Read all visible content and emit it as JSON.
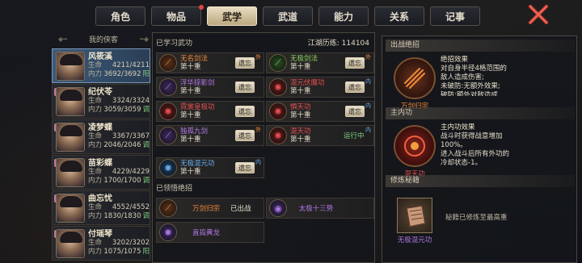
{
  "tabs": [
    {
      "label": "角色",
      "active": false
    },
    {
      "label": "物品",
      "active": false,
      "dot": true
    },
    {
      "label": "武学",
      "active": true
    },
    {
      "label": "武道",
      "active": false
    },
    {
      "label": "能力",
      "active": false
    },
    {
      "label": "关系",
      "active": false
    },
    {
      "label": "记事",
      "active": false
    }
  ],
  "roster": {
    "header": "我的侠客",
    "characters": [
      {
        "name": "风筱溪",
        "hp_label": "生命",
        "hp": "4211/4211",
        "mp_label": "内力",
        "mp": "3692/3692",
        "tag": "阳",
        "selected": true
      },
      {
        "name": "纪伏苓",
        "hp_label": "生命",
        "hp": "3324/3324",
        "mp_label": "内力",
        "mp": "3059/3059",
        "tag": "调",
        "selected": false
      },
      {
        "name": "凌梦蝶",
        "hp_label": "生命",
        "hp": "3367/3367",
        "mp_label": "内力",
        "mp": "2046/2046",
        "tag": "调",
        "selected": false
      },
      {
        "name": "苗彩蝶",
        "hp_label": "生命",
        "hp": "4229/4229",
        "mp_label": "内力",
        "mp": "1700/1700",
        "tag": "调",
        "selected": false
      },
      {
        "name": "曲忘忧",
        "hp_label": "生命",
        "hp": "4552/4552",
        "mp_label": "内力",
        "mp": "1830/1830",
        "tag": "调",
        "selected": false
      },
      {
        "name": "付瑶琴",
        "hp_label": "生命",
        "hp": "3202/3202",
        "mp_label": "内力",
        "mp": "1075/1075",
        "tag": "阳",
        "selected": false
      }
    ]
  },
  "learned": {
    "title": "已学习武功",
    "history_label": "江湖历练:",
    "history_value": "114104",
    "skills": [
      {
        "name": "无名剑法",
        "level": "第十重",
        "action": "遗忘",
        "color": "orange",
        "corner": "外"
      },
      {
        "name": "无极剑法",
        "level": "第十重",
        "action": "遗忘",
        "color": "green",
        "corner": "外"
      },
      {
        "name": "浮华掠影剑",
        "level": "第十重",
        "action": "遗忘",
        "color": "purple",
        "corner": ""
      },
      {
        "name": "混元伏魔功",
        "level": "第十重",
        "action": "遗忘",
        "color": "red",
        "corner": "内"
      },
      {
        "name": "霓裳皇极功",
        "level": "第十重",
        "action": "遗忘",
        "color": "red",
        "corner": ""
      },
      {
        "name": "惧天功",
        "level": "第十重",
        "action": "遗忘",
        "color": "red",
        "corner": "内"
      },
      {
        "name": "独孤九剑",
        "level": "第十重",
        "action": "遗忘",
        "color": "purple",
        "corner": "外"
      },
      {
        "name": "混天功",
        "level": "第十重",
        "action": "运行中",
        "color": "red",
        "corner": "内"
      },
      {
        "name": "无极混元功",
        "level": "第十重",
        "action": "遗忘",
        "color": "blue",
        "corner": "内"
      }
    ]
  },
  "ultimates": {
    "title": "已领悟绝招",
    "items": [
      {
        "name": "万剑归宗",
        "state": "已出战",
        "color": "orange"
      },
      {
        "name": "太极十三势",
        "state": "",
        "color": "purple"
      },
      {
        "name": "直捣黄龙",
        "state": "",
        "color": "purple"
      }
    ]
  },
  "detail": {
    "ult_title": "出战绝招",
    "ult_name": "万剑归宗",
    "ult_effect_title": "绝招效果",
    "ult_effect_lines": [
      "对自身半径4格范围的",
      "敌人造成伤害;",
      "未破防:无额外效果;",
      "破防:额外对敌造成"
    ],
    "inner_title": "主内功",
    "inner_name": "混天功",
    "inner_effect_title": "主内功效果",
    "inner_effect_lines": [
      "战斗时获得战意增加",
      "100%。",
      "进入战斗后所有外功的",
      "冷却状态-1。"
    ],
    "secret_title": "修炼秘籍",
    "secret_name": "无极混元功",
    "secret_note": "秘籍已修炼至最高重"
  },
  "colors": {
    "orange": "#f08a3a",
    "green": "#8ad060",
    "purple": "#b07ae8",
    "red": "#e85050",
    "blue": "#6ab0f0"
  }
}
